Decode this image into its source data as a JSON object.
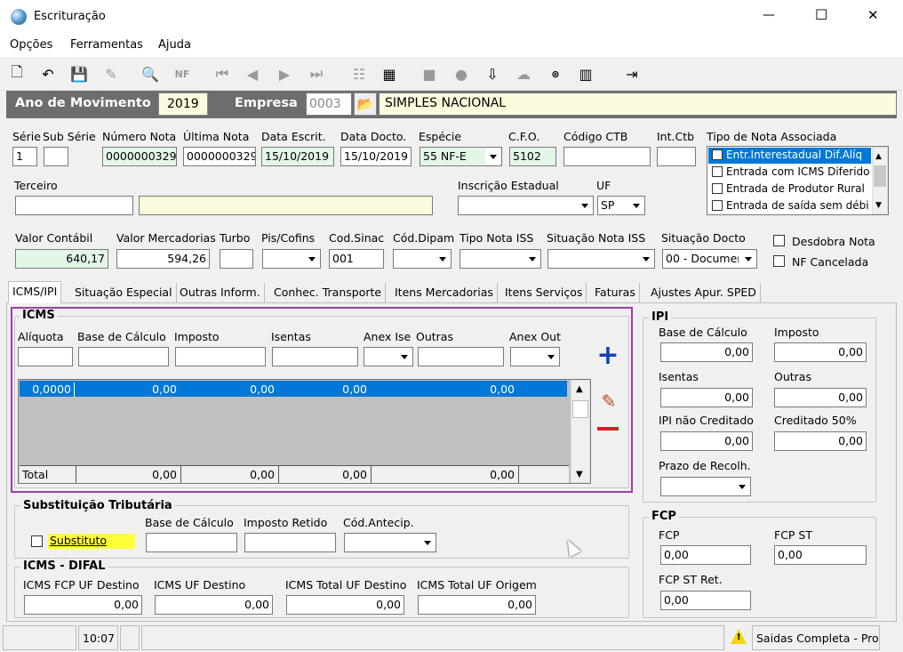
{
  "window": {
    "title": "Escrituração",
    "btn_min": "—",
    "btn_max": "☐",
    "btn_close": "✕"
  },
  "menu": [
    "Opções",
    "Ferramentas",
    "Ajuda"
  ],
  "header": {
    "ano_label": "Ano de Movimento",
    "ano": "2019",
    "empresa_label": "Empresa",
    "empresa_code": "0003",
    "empresa_name": "SIMPLES NACIONAL"
  },
  "labels": {
    "serie": "Série",
    "sub_serie": "Sub Série",
    "numero_nota": "Número Nota",
    "ultima_nota": "Última Nota",
    "data_escrit": "Data Escrit.",
    "data_docto": "Data Docto.",
    "especie": "Espécie",
    "cfo": "C.F.O.",
    "codigo_ctb": "Código CTB",
    "int_ctb": "Int.Ctb",
    "tipo_nota": "Tipo de Nota Associada",
    "terceiro": "Terceiro",
    "inscricao": "Inscrição Estadual",
    "uf": "UF",
    "valor_contabil": "Valor Contábil",
    "valor_merc": "Valor Mercadorias",
    "turbo": "Turbo",
    "pis": "Pis/Cofins",
    "cod_sinac": "Cod.Sinac",
    "cod_dipam": "Cód.Dipam",
    "tipo_iss": "Tipo Nota ISS",
    "sit_iss": "Situação Nota ISS",
    "sit_docto": "Situação Docto",
    "desdobra": "Desdobra Nota",
    "nf_cancel": "NF Cancelada"
  },
  "values": {
    "serie": "1",
    "sub_serie": "",
    "numero_nota": "0000000329",
    "ultima_nota": "0000000329",
    "data_escrit": "15/10/2019",
    "data_docto": "15/10/2019",
    "especie": "55   NF-E",
    "cfo": "5102",
    "uf": "SP",
    "valor_contabil": "640,17",
    "valor_merc": "594,26",
    "cod_sinac": "001",
    "sit_docto": "00 - Documen"
  },
  "tipo_nota_items": [
    "Entr.Interestadual Dif.Alíq",
    "Entrada com ICMS Diferido",
    "Entrada de Produtor Rural",
    "Entrada de saída sem débi"
  ],
  "tabs": [
    "ICMS/IPI",
    "Situação Especial",
    "Outras Inform.",
    "Conhec. Transporte",
    "Itens Mercadorias",
    "Itens Serviços",
    "Faturas",
    "Ajustes Apur. SPED"
  ],
  "icms": {
    "title": "ICMS",
    "cols": [
      "Alíquota",
      "Base de Cálculo",
      "Imposto",
      "Isentas",
      "Anex Ise",
      "Outras",
      "Anex Out"
    ],
    "row": [
      "0,0000",
      "0,00",
      "0,00",
      "0,00",
      "0,00"
    ],
    "total_label": "Total",
    "totals": [
      "0,00",
      "0,00",
      "0,00",
      "0,00"
    ]
  },
  "st": {
    "title": "Substituição Tributária",
    "base": "Base de Cálculo",
    "imposto": "Imposto Retido",
    "cod": "Cód.Antecip.",
    "substituto": "Substituto"
  },
  "difal": {
    "title": "ICMS - DIFAL",
    "labels": [
      "ICMS FCP UF Destino",
      "ICMS UF Destino",
      "ICMS Total UF Destino",
      "ICMS Total UF Origem"
    ],
    "values": [
      "0,00",
      "0,00",
      "0,00",
      "0,00"
    ]
  },
  "ipi": {
    "title": "IPI",
    "base": "Base de Cálculo",
    "imposto": "Imposto",
    "isentas": "Isentas",
    "outras": "Outras",
    "nao_cred": "IPI não Creditado",
    "cred50": "Creditado 50%",
    "prazo": "Prazo de Recolh.",
    "v": [
      "0,00",
      "0,00",
      "0,00",
      "0,00",
      "0,00",
      "0,00"
    ]
  },
  "fcp": {
    "title": "FCP",
    "fcp": "FCP",
    "fcp_st": "FCP ST",
    "fcp_st_ret": "FCP ST Ret.",
    "v": [
      "0,00",
      "0,00",
      "0,00"
    ]
  },
  "status": {
    "time": "10:07",
    "msg": "Saidas Completa - Pros"
  },
  "colors": {
    "accent": "#0078d7",
    "header_bar": "#6d6d6d",
    "frame": "#9b3fa8"
  }
}
